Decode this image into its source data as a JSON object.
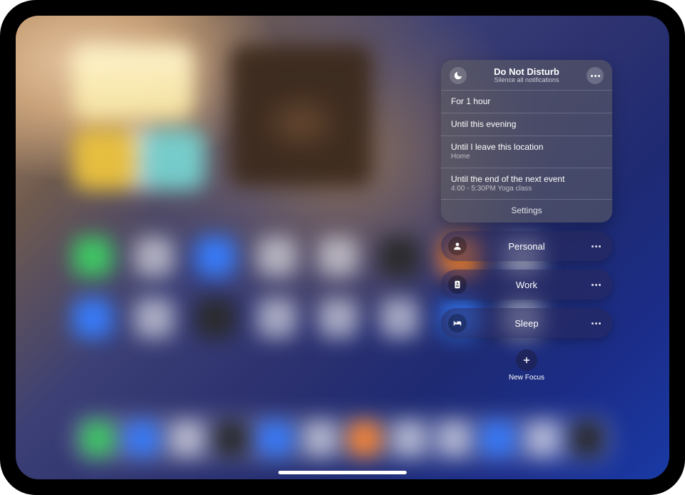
{
  "dnd": {
    "title": "Do Not Disturb",
    "subtitle": "Silence all notifications",
    "options": [
      {
        "label": "For 1 hour",
        "sub": ""
      },
      {
        "label": "Until this evening",
        "sub": ""
      },
      {
        "label": "Until I leave this location",
        "sub": "Home"
      },
      {
        "label": "Until the end of the next event",
        "sub": "4:00 - 5:30PM Yoga class"
      }
    ],
    "settings_label": "Settings"
  },
  "focuses": [
    {
      "id": "personal",
      "label": "Personal",
      "icon": "person"
    },
    {
      "id": "work",
      "label": "Work",
      "icon": "badge"
    },
    {
      "id": "sleep",
      "label": "Sleep",
      "icon": "bed"
    }
  ],
  "new_focus": {
    "label": "New Focus"
  }
}
